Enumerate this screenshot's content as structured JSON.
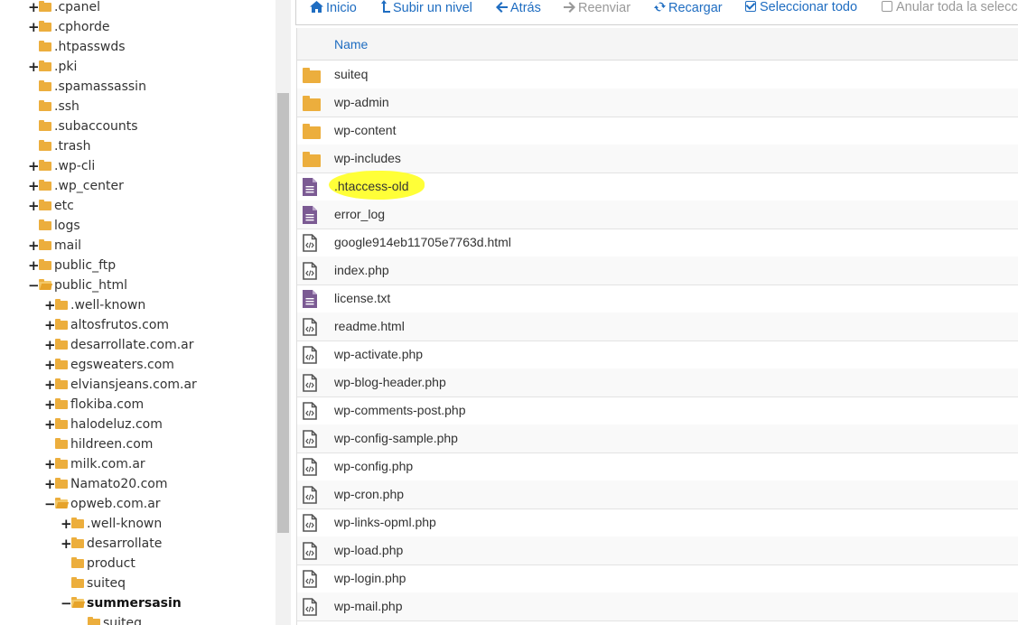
{
  "tree": [
    {
      "label": ".cpanel",
      "depth": 0,
      "toggle": "+"
    },
    {
      "label": ".cphorde",
      "depth": 0,
      "toggle": "+"
    },
    {
      "label": ".htpasswds",
      "depth": 0,
      "toggle": ""
    },
    {
      "label": ".pki",
      "depth": 0,
      "toggle": "+"
    },
    {
      "label": ".spamassassin",
      "depth": 0,
      "toggle": ""
    },
    {
      "label": ".ssh",
      "depth": 0,
      "toggle": ""
    },
    {
      "label": ".subaccounts",
      "depth": 0,
      "toggle": ""
    },
    {
      "label": ".trash",
      "depth": 0,
      "toggle": ""
    },
    {
      "label": ".wp-cli",
      "depth": 0,
      "toggle": "+"
    },
    {
      "label": ".wp_center",
      "depth": 0,
      "toggle": "+"
    },
    {
      "label": "etc",
      "depth": 0,
      "toggle": "+"
    },
    {
      "label": "logs",
      "depth": 0,
      "toggle": ""
    },
    {
      "label": "mail",
      "depth": 0,
      "toggle": "+"
    },
    {
      "label": "public_ftp",
      "depth": 0,
      "toggle": "+"
    },
    {
      "label": "public_html",
      "depth": 0,
      "toggle": "−",
      "open": true
    },
    {
      "label": ".well-known",
      "depth": 1,
      "toggle": "+"
    },
    {
      "label": "altosfrutos.com",
      "depth": 1,
      "toggle": "+"
    },
    {
      "label": "desarrollate.com.ar",
      "depth": 1,
      "toggle": "+"
    },
    {
      "label": "egsweaters.com",
      "depth": 1,
      "toggle": "+"
    },
    {
      "label": "elviansjeans.com.ar",
      "depth": 1,
      "toggle": "+"
    },
    {
      "label": "flokiba.com",
      "depth": 1,
      "toggle": "+"
    },
    {
      "label": "halodeluz.com",
      "depth": 1,
      "toggle": "+"
    },
    {
      "label": "hildreen.com",
      "depth": 1,
      "toggle": ""
    },
    {
      "label": "milk.com.ar",
      "depth": 1,
      "toggle": "+"
    },
    {
      "label": "Namato20.com",
      "depth": 1,
      "toggle": "+"
    },
    {
      "label": "opweb.com.ar",
      "depth": 1,
      "toggle": "−",
      "open": true
    },
    {
      "label": ".well-known",
      "depth": 2,
      "toggle": "+"
    },
    {
      "label": "desarrollate",
      "depth": 2,
      "toggle": "+"
    },
    {
      "label": "product",
      "depth": 2,
      "toggle": ""
    },
    {
      "label": "suiteq",
      "depth": 2,
      "toggle": ""
    },
    {
      "label": "summersasin",
      "depth": 2,
      "toggle": "−",
      "open": true,
      "bold": true
    },
    {
      "label": "suiteq",
      "depth": 3,
      "toggle": ""
    }
  ],
  "toolbar": {
    "home": "Inicio",
    "up": "Subir un nivel",
    "back": "Atrás",
    "forward": "Reenviar",
    "reload": "Recargar",
    "select_all": "Seleccionar todo",
    "deselect_all": "Anular toda la selecc"
  },
  "files": {
    "column_name": "Name",
    "rows": [
      {
        "name": "suiteq",
        "type": "folder"
      },
      {
        "name": "wp-admin",
        "type": "folder"
      },
      {
        "name": "wp-content",
        "type": "folder"
      },
      {
        "name": "wp-includes",
        "type": "folder"
      },
      {
        "name": ".htaccess-old",
        "type": "text",
        "highlight": true
      },
      {
        "name": "error_log",
        "type": "text"
      },
      {
        "name": "google914eb11705e7763d.html",
        "type": "code"
      },
      {
        "name": "index.php",
        "type": "code"
      },
      {
        "name": "license.txt",
        "type": "text"
      },
      {
        "name": "readme.html",
        "type": "code"
      },
      {
        "name": "wp-activate.php",
        "type": "code"
      },
      {
        "name": "wp-blog-header.php",
        "type": "code"
      },
      {
        "name": "wp-comments-post.php",
        "type": "code"
      },
      {
        "name": "wp-config-sample.php",
        "type": "code"
      },
      {
        "name": "wp-config.php",
        "type": "code"
      },
      {
        "name": "wp-cron.php",
        "type": "code"
      },
      {
        "name": "wp-links-opml.php",
        "type": "code"
      },
      {
        "name": "wp-load.php",
        "type": "code"
      },
      {
        "name": "wp-login.php",
        "type": "code"
      },
      {
        "name": "wp-mail.php",
        "type": "code"
      }
    ]
  },
  "colors": {
    "link": "#1f6dc1",
    "folder": "#ecae3d",
    "text_file_icon": "#7b5a93",
    "highlight": "#ffff38"
  }
}
